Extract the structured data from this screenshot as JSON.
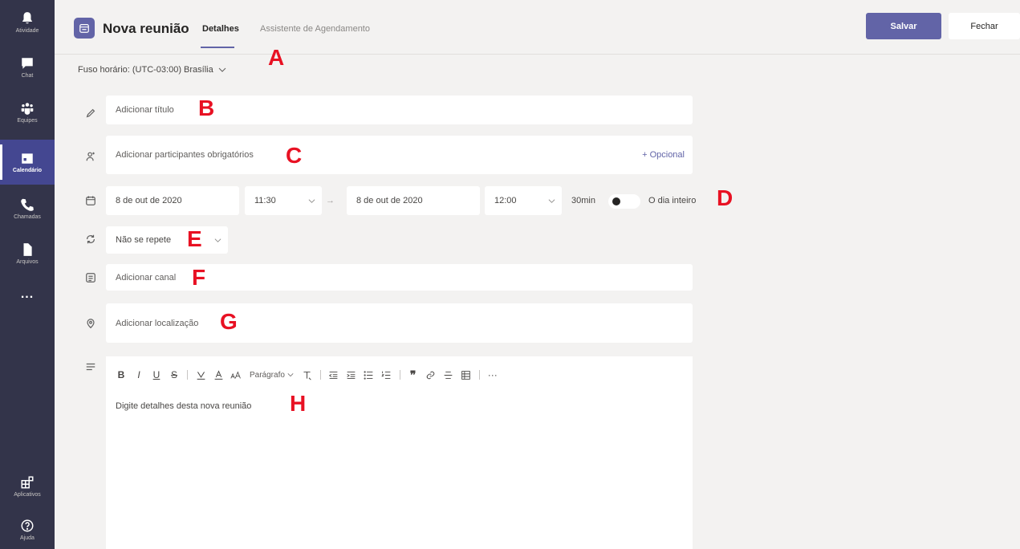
{
  "rail": {
    "items": [
      {
        "label": "Atividade",
        "icon": "bell-icon"
      },
      {
        "label": "Chat",
        "icon": "chat-icon"
      },
      {
        "label": "Equipes",
        "icon": "teams-icon"
      },
      {
        "label": "Calendário",
        "icon": "calendar-icon"
      },
      {
        "label": "Chamadas",
        "icon": "phone-icon"
      },
      {
        "label": "Arquivos",
        "icon": "file-icon"
      }
    ],
    "more": "...",
    "bottom": [
      {
        "label": "Aplicativos",
        "icon": "apps-icon"
      },
      {
        "label": "Ajuda",
        "icon": "help-icon"
      }
    ],
    "active": "Calendário"
  },
  "header": {
    "title": "Nova reunião",
    "tabs": [
      {
        "label": "Detalhes",
        "active": true
      },
      {
        "label": "Assistente de Agendamento",
        "active": false
      }
    ],
    "save_label": "Salvar",
    "close_label": "Fechar"
  },
  "timezone": "Fuso horário: (UTC-03:00) Brasília",
  "form": {
    "title_placeholder": "Adicionar título",
    "attendees_placeholder": "Adicionar participantes obrigatórios",
    "optional_label": "+ Opcional",
    "start_date": "8 de out de 2020",
    "start_time": "11:30",
    "end_date": "8 de out de 2020",
    "end_time": "12:00",
    "duration": "30min",
    "all_day_label": "O dia inteiro",
    "all_day_on": false,
    "repeat": "Não se repete",
    "channel_placeholder": "Adicionar canal",
    "location_placeholder": "Adicionar localização",
    "details_placeholder": "Digite detalhes desta nova reunião"
  },
  "editor_toolbar": {
    "bold": "B",
    "italic": "I",
    "underline": "U",
    "strike": "S",
    "paragraph": "Parágrafo",
    "more": "···"
  },
  "annotations": [
    "A",
    "B",
    "C",
    "D",
    "E",
    "F",
    "G",
    "H"
  ],
  "colors": {
    "accent": "#6264a7",
    "rail": "#33344a",
    "background": "#f3f2f1",
    "annotation": "#e81123"
  }
}
